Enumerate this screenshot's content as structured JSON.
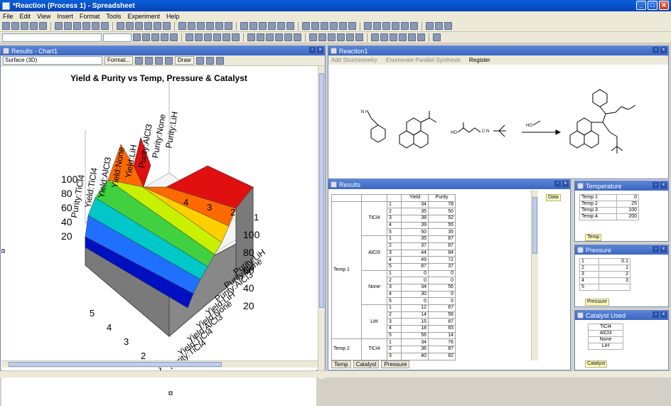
{
  "window": {
    "title": "*Reaction (Process 1) - Spreadsheet",
    "min": "_",
    "max": "□",
    "close": "✕"
  },
  "menu": [
    "File",
    "Edit",
    "View",
    "Insert",
    "Format",
    "Tools",
    "Experiment",
    "Help"
  ],
  "chart_panel": {
    "title": "Results - Chart1",
    "chart_type_value": "Surface (3D)",
    "format_label": "Format...",
    "draw_label": "Draw"
  },
  "chart_data": {
    "type": "surface3d",
    "title": "Yield & Purity vs Temp, Pressure & Catalyst",
    "z_ticks": [
      "20",
      "40",
      "60",
      "80",
      "100"
    ],
    "left_axis_ticks": [
      "5",
      "4",
      "3",
      "2",
      "1"
    ],
    "back_axis_ticks": [
      "4",
      "3",
      "2",
      "1"
    ],
    "series_labels": [
      "Purity:TiCl4",
      "Yield:TiCl4",
      "Yield:AlCl3",
      "Yield:None",
      "Yield:LiH",
      "Purity:AlCl3",
      "Purity:None",
      "Purity:LiH"
    ],
    "front_series_labels": [
      "Purity:LiH",
      "Purity:None",
      "Purity:AlCl3",
      "Yield:LiH",
      "Yield:None",
      "Yield:AlCl3",
      "Yield:TiCl4",
      "Purity:TiCl4"
    ],
    "colors": [
      "#e01010",
      "#ff6a00",
      "#ffd000",
      "#c8f000",
      "#40d040",
      "#00c8c8",
      "#2070ff",
      "#0010c0"
    ]
  },
  "reaction_panel": {
    "title": "Reaction1",
    "add_stoich": "Add Stoichiometry",
    "enumerate": "Enumerate Parallel Synthesis",
    "register": "Register",
    "label_nh": "N H",
    "label_ho": "HO",
    "label_cn": "C N"
  },
  "results_panel": {
    "title": "Results",
    "data_tag": "Data",
    "headers": [
      "Yield",
      "Purity"
    ],
    "groups": [
      {
        "temp": "Temp 1",
        "catalysts": [
          {
            "name": "TiCl4",
            "rows": [
              [
                "1",
                "34",
                "78"
              ],
              [
                "2",
                "35",
                "50"
              ],
              [
                "3",
                "38",
                "52"
              ],
              [
                "4",
                "39",
                "55"
              ],
              [
                "5",
                "50",
                "35"
              ]
            ]
          },
          {
            "name": "AlCl3",
            "rows": [
              [
                "1",
                "35",
                "87"
              ],
              [
                "2",
                "37",
                "87"
              ],
              [
                "3",
                "44",
                "84"
              ],
              [
                "4",
                "49",
                "72"
              ],
              [
                "5",
                "87",
                "37"
              ]
            ]
          },
          {
            "name": "None",
            "rows": [
              [
                "1",
                "0",
                "0"
              ],
              [
                "2",
                "0",
                "0"
              ],
              [
                "3",
                "34",
                "56"
              ],
              [
                "4",
                "30",
                "0"
              ],
              [
                "5",
                "0",
                "0"
              ]
            ]
          },
          {
            "name": "LiH",
            "rows": [
              [
                "1",
                "12",
                "67"
              ],
              [
                "2",
                "14",
                "56"
              ],
              [
                "3",
                "15",
                "87"
              ],
              [
                "4",
                "18",
                "65"
              ],
              [
                "5",
                "56",
                "14"
              ]
            ]
          }
        ]
      },
      {
        "temp": "Temp 2",
        "catalysts": [
          {
            "name": "TiCl4",
            "rows": [
              [
                "1",
                "34",
                "76"
              ],
              [
                "2",
                "36",
                "87"
              ],
              [
                "3",
                "40",
                "82"
              ]
            ]
          }
        ]
      }
    ],
    "tabs": [
      "Temp",
      "Catalyst",
      "Pressure"
    ]
  },
  "temperature_panel": {
    "title": "Temperature",
    "rows": [
      [
        "Temp 1",
        "0"
      ],
      [
        "Temp 2",
        "25"
      ],
      [
        "Temp 3",
        "100"
      ],
      [
        "Temp 4",
        "200"
      ]
    ],
    "tag": "Temp"
  },
  "pressure_panel": {
    "title": "Pressure",
    "rows": [
      [
        "1",
        "0.1"
      ],
      [
        "2",
        "1"
      ],
      [
        "3",
        "2"
      ],
      [
        "4",
        "3"
      ],
      [
        "5",
        ""
      ]
    ],
    "tag": "Pressure"
  },
  "catalyst_panel": {
    "title": "Catalyst Used",
    "rows": [
      "TiCl4",
      "AlCl3",
      "None",
      "LiH"
    ],
    "tag": "Catalyst"
  }
}
